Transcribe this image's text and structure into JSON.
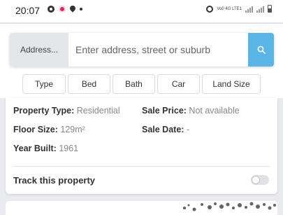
{
  "status_bar": {
    "time": "20:07",
    "network_text": "Vo0 4G LTE1"
  },
  "search": {
    "address_type": "Address...",
    "placeholder": "Enter address, street or suburb",
    "search_icon": "search-icon"
  },
  "filters": [
    "Type",
    "Bed",
    "Bath",
    "Car",
    "Land Size"
  ],
  "property": {
    "type_label": "Property Type:",
    "type_value": "Residential",
    "sale_price_label": "Sale Price:",
    "sale_price_value": "Not available",
    "floor_size_label": "Floor Size:",
    "floor_size_value": "129m²",
    "sale_date_label": "Sale Date:",
    "sale_date_value": "-",
    "year_built_label": "Year Built:",
    "year_built_value": "1961"
  },
  "track": {
    "label": "Track this property",
    "enabled": false
  },
  "colors": {
    "accent": "#5ab4e6",
    "background": "#e9ebee"
  }
}
